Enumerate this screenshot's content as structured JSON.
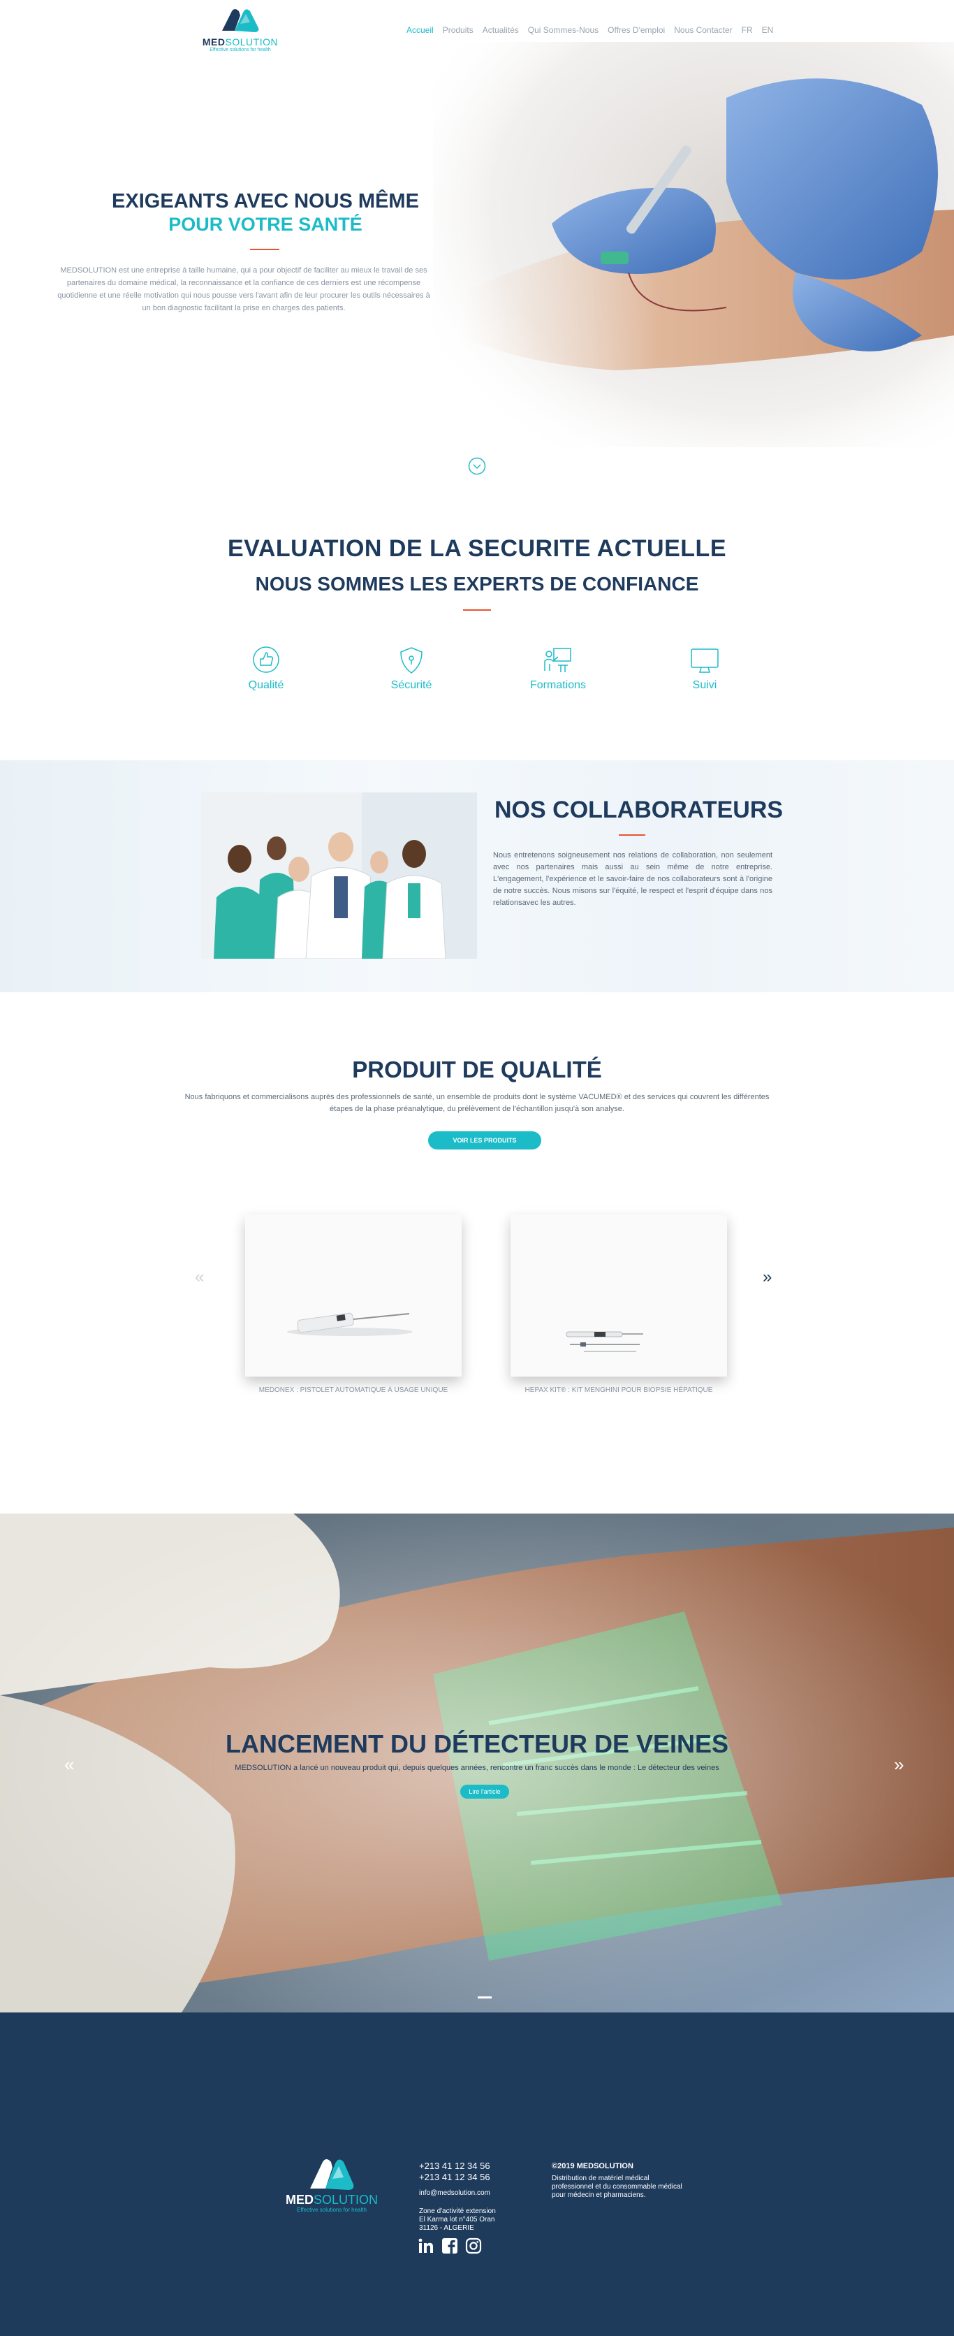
{
  "header": {
    "logo_word_a": "MED",
    "logo_word_b": "SOLUTION",
    "logo_tagline": "Effective solutions for health",
    "nav": [
      "Accueil",
      "Produits",
      "Actualités",
      "Qui Sommes-Nous",
      "Offres D'emploi",
      "Nous Contacter",
      "FR",
      "EN"
    ]
  },
  "hero": {
    "title_line1": "EXIGEANTS AVEC NOUS MÊME",
    "title_line2": "POUR VOTRE SANTÉ",
    "paragraph": "MEDSOLUTION est une entreprise à taille humaine, qui a pour objectif de faciliter au mieux le travail de ses partenaires du domaine médical, la reconnaissance et la confiance de ces derniers est une récompense quotidienne et une réelle motivation qui nous pousse vers l'avant afin de leur procurer les outils nécessaires à un bon diagnostic facilitant la prise en charges des patients."
  },
  "evaluation": {
    "title_line1": "EVALUATION DE LA SECURITE ACTUELLE",
    "title_line2": "NOUS SOMMES LES EXPERTS DE CONFIANCE",
    "features": [
      "Qualité",
      "Sécurité",
      "Formations",
      "Suivi"
    ]
  },
  "collaborateurs": {
    "title_light": "NOS",
    "title_bold": "COLLABORATEURS",
    "paragraph": "Nous entretenons soigneusement nos relations de collaboration, non seulement avec nos partenaires mais aussi au sein même de notre entreprise. L'engagement, l'expérience et le savoir-faire de nos collaborateurs sont à l'origine de notre succès. Nous misons sur l'équité, le respect et l'esprit d'équipe dans nos relationsavec les autres."
  },
  "products": {
    "title": "PRODUIT DE QUALITÉ",
    "paragraph": "Nous fabriquons et commercialisons auprès des professionnels de santé, un ensemble de produits dont le système VACUMED® et des services qui couvrent les différentes étapes de la phase préanalytique, du prélèvement de l'échantillon jusqu'à son analyse.",
    "button": "VOIR LES PRODUITS",
    "prev_arrow": "«",
    "next_arrow": "»",
    "items": [
      {
        "caption": "MEDONEX : PISTOLET AUTOMATIQUE À USAGE UNIQUE"
      },
      {
        "caption": "HEPAX KIT® : KIT MENGHINI POUR BIOPSIE HÉPATIQUE"
      }
    ]
  },
  "banner": {
    "title": "LANCEMENT DU DÉTECTEUR DE VEINES",
    "text": "MEDSOLUTION a lancé un nouveau produit qui, depuis quelques années, rencontre un franc succès dans le monde : Le détecteur des veines",
    "button": "Lire l'article",
    "prev_arrow": "«",
    "next_arrow": "»"
  },
  "footer": {
    "logo_word_a": "MED",
    "logo_word_b": "SOLUTION",
    "logo_tagline": "Effective solutions for health",
    "phone1": "+213 41 12 34 56",
    "phone2": "+213 41 12 34 56",
    "email": "info@medsolution.com",
    "address1": "Zone d'activité extension",
    "address2": "El Karma lot n°405 Oran",
    "address3": "31126 - ALGERIE",
    "copyright": "©2019 MEDSOLUTION",
    "description": "Distribution de matériel médical professionnel et du consommable médical pour médecin et pharmaciens.",
    "social": [
      "linkedin-icon",
      "facebook-icon",
      "instagram-icon"
    ]
  },
  "colors": {
    "navy": "#1e3a5c",
    "teal": "#1bbcc8",
    "accent": "#e8542f",
    "footer_bg": "#1f3b5c"
  }
}
